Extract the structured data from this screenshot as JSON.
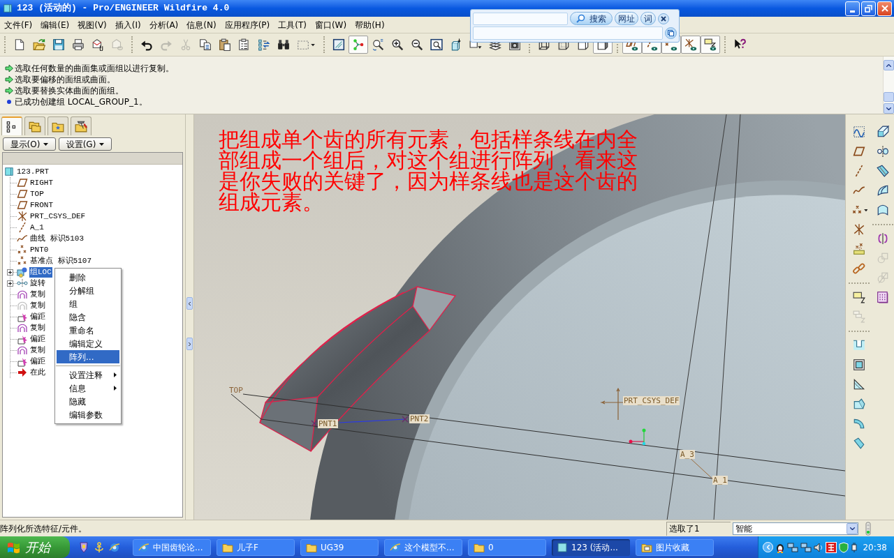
{
  "window": {
    "title": "123 (活动的) - Pro/ENGINEER Wildfire 4.0"
  },
  "search_popup": {
    "search_button": "搜索",
    "tabs": [
      "网址",
      "词"
    ]
  },
  "menu": [
    "文件(F)",
    "编辑(E)",
    "视图(V)",
    "插入(I)",
    "分析(A)",
    "信息(N)",
    "应用程序(P)",
    "工具(T)",
    "窗口(W)",
    "帮助(H)"
  ],
  "toolbar": [
    [
      {
        "kind": "new",
        "disabled": false,
        "pressed": false
      },
      {
        "kind": "open",
        "disabled": false,
        "pressed": false
      },
      {
        "kind": "save",
        "disabled": false,
        "pressed": false
      },
      {
        "kind": "print",
        "disabled": false,
        "pressed": false
      },
      {
        "kind": "mail",
        "disabled": false,
        "pressed": false
      },
      {
        "kind": "sendlink",
        "disabled": true,
        "pressed": false
      }
    ],
    [
      {
        "kind": "undo",
        "disabled": false,
        "pressed": false
      },
      {
        "kind": "redo",
        "disabled": true,
        "pressed": false
      },
      {
        "kind": "cut",
        "disabled": true,
        "pressed": false
      },
      {
        "kind": "copy",
        "disabled": false,
        "pressed": false
      },
      {
        "kind": "paste",
        "disabled": false,
        "pressed": false
      },
      {
        "kind": "pastespecial",
        "disabled": false,
        "pressed": false
      },
      {
        "kind": "regenerate",
        "disabled": false,
        "pressed": false
      },
      {
        "kind": "find",
        "disabled": false,
        "pressed": false
      },
      {
        "kind": "selectbox",
        "disabled": false,
        "pressed": false
      }
    ],
    [
      {
        "kind": "repaint",
        "disabled": false,
        "pressed": false
      },
      {
        "kind": "spincenter",
        "disabled": false,
        "pressed": true
      },
      {
        "kind": "orient",
        "disabled": false,
        "pressed": false
      },
      {
        "kind": "zoomin",
        "disabled": false,
        "pressed": false
      },
      {
        "kind": "zoomout",
        "disabled": false,
        "pressed": false
      },
      {
        "kind": "refit",
        "disabled": false,
        "pressed": false
      },
      {
        "kind": "reorient",
        "disabled": false,
        "pressed": false
      },
      {
        "kind": "views",
        "disabled": false,
        "pressed": false
      },
      {
        "kind": "layers",
        "disabled": false,
        "pressed": false
      },
      {
        "kind": "camera",
        "disabled": false,
        "pressed": false
      }
    ],
    [
      {
        "kind": "wireframe",
        "disabled": false,
        "pressed": false
      },
      {
        "kind": "hidden",
        "disabled": false,
        "pressed": false
      },
      {
        "kind": "nohidden",
        "disabled": false,
        "pressed": false
      },
      {
        "kind": "shaded",
        "disabled": false,
        "pressed": true
      }
    ],
    [
      {
        "kind": "planes",
        "disabled": false,
        "pressed": true
      },
      {
        "kind": "axes",
        "disabled": false,
        "pressed": true
      },
      {
        "kind": "points",
        "disabled": false,
        "pressed": true
      },
      {
        "kind": "csystoggle",
        "disabled": false,
        "pressed": true
      },
      {
        "kind": "annot",
        "disabled": false,
        "pressed": true
      }
    ],
    [
      {
        "kind": "help",
        "disabled": false,
        "pressed": false
      }
    ]
  ],
  "messages": [
    {
      "kind": "prompt",
      "text": "选取任何数量的曲面集或面组以进行复制。"
    },
    {
      "kind": "prompt",
      "text": "选取要偏移的面组或曲面。"
    },
    {
      "kind": "prompt",
      "text": "选取要替换实体曲面的面组。"
    },
    {
      "kind": "info",
      "text": "已成功创建组 LOCAL_GROUP_1。"
    }
  ],
  "model_tree": {
    "tabs": [
      {
        "kind": "tree",
        "selected": true
      },
      {
        "kind": "folders",
        "selected": false
      },
      {
        "kind": "favorites",
        "selected": false
      },
      {
        "kind": "tools",
        "selected": false
      }
    ],
    "menus": [
      "显示(O)",
      "设置(G)"
    ],
    "root": {
      "label": "123.PRT",
      "kind": "part",
      "children": [
        {
          "label": "RIGHT",
          "kind": "plane",
          "collapsed": false,
          "selected": false
        },
        {
          "label": "TOP",
          "kind": "plane",
          "collapsed": false,
          "selected": false
        },
        {
          "label": "FRONT",
          "kind": "plane",
          "collapsed": false,
          "selected": false
        },
        {
          "label": "PRT_CSYS_DEF",
          "kind": "csys",
          "collapsed": false,
          "selected": false
        },
        {
          "label": "A_1",
          "kind": "axis",
          "collapsed": false,
          "selected": false
        },
        {
          "label": "曲线 标识5103",
          "kind": "curve",
          "collapsed": false,
          "selected": false
        },
        {
          "label": "PNT0",
          "kind": "points",
          "collapsed": false,
          "selected": false
        },
        {
          "label": "基准点 标识5107",
          "kind": "points",
          "collapsed": false,
          "selected": false
        },
        {
          "label": "组LOC",
          "kind": "group",
          "collapsed": true,
          "selected": true
        },
        {
          "label": "旋转",
          "kind": "revolve",
          "collapsed": true,
          "selected": false
        },
        {
          "label": "复制",
          "kind": "copy",
          "collapsed": false,
          "selected": false
        },
        {
          "label": "复制",
          "kind": "copyhidden",
          "collapsed": false,
          "selected": false
        },
        {
          "label": "偏距",
          "kind": "offset",
          "collapsed": false,
          "selected": false
        },
        {
          "label": "复制",
          "kind": "copy",
          "collapsed": false,
          "selected": false
        },
        {
          "label": "偏距",
          "kind": "offset",
          "collapsed": false,
          "selected": false
        },
        {
          "label": "复制",
          "kind": "copy",
          "collapsed": false,
          "selected": false
        },
        {
          "label": "偏距",
          "kind": "offset",
          "collapsed": false,
          "selected": false
        },
        {
          "label": "在此",
          "kind": "insert",
          "collapsed": false,
          "selected": false
        }
      ]
    }
  },
  "context_menu": {
    "groups": [
      [
        {
          "label": "删除",
          "selected": false,
          "submenu": false
        },
        {
          "label": "分解组",
          "selected": false,
          "submenu": false
        },
        {
          "label": "组",
          "selected": false,
          "submenu": false
        },
        {
          "label": "隐含",
          "selected": false,
          "submenu": false
        },
        {
          "label": "重命名",
          "selected": false,
          "submenu": false
        },
        {
          "label": "编辑定义",
          "selected": false,
          "submenu": false
        },
        {
          "label": "阵列...",
          "selected": true,
          "submenu": false
        }
      ],
      [
        {
          "label": "设置注释",
          "selected": false,
          "submenu": true
        },
        {
          "label": "信息",
          "selected": false,
          "submenu": true
        },
        {
          "label": "隐藏",
          "selected": false,
          "submenu": false
        },
        {
          "label": "编辑参数",
          "selected": false,
          "submenu": false
        }
      ]
    ]
  },
  "viewport": {
    "annotation": "把组成单个齿的所有元素，包括样条线在内全部组成一个组后，对这个组进行阵列，看来这是你失败的关键了，因为样条线也是这个齿的组成元素。",
    "datum_labels": [
      {
        "text": "TOP",
        "kind": "plane"
      },
      {
        "text": "PNT1",
        "kind": "point"
      },
      {
        "text": "PNT2",
        "kind": "point"
      },
      {
        "text": "PRT_CSYS_DEF",
        "kind": "csys"
      },
      {
        "text": "A_3",
        "kind": "axis"
      },
      {
        "text": "A_1",
        "kind": "axis"
      }
    ]
  },
  "right_toolbar": {
    "columns": [
      [
        [
          {
            "kind": "sketch",
            "disabled": false
          },
          {
            "kind": "plane",
            "disabled": false
          },
          {
            "kind": "axis",
            "disabled": false
          },
          {
            "kind": "curve",
            "disabled": false
          },
          {
            "kind": "point",
            "disabled": false
          },
          {
            "kind": "csys",
            "disabled": false
          },
          {
            "kind": "pointbar",
            "disabled": false
          },
          {
            "kind": "chain",
            "disabled": false
          }
        ],
        [
          {
            "kind": "group",
            "disabled": false
          },
          {
            "kind": "groupstack",
            "disabled": true
          }
        ],
        [
          {
            "kind": "hole",
            "disabled": false
          },
          {
            "kind": "shell",
            "disabled": false
          },
          {
            "kind": "rib",
            "disabled": false
          },
          {
            "kind": "draft",
            "disabled": false
          },
          {
            "kind": "round",
            "disabled": false
          },
          {
            "kind": "chamfer",
            "disabled": false
          }
        ]
      ],
      [
        [
          {
            "kind": "extrude",
            "disabled": false
          },
          {
            "kind": "revolvefeat",
            "disabled": false
          },
          {
            "kind": "sweep",
            "disabled": false
          },
          {
            "kind": "blend",
            "disabled": false
          },
          {
            "kind": "boundary",
            "disabled": false
          }
        ],
        [
          {
            "kind": "mirror",
            "disabled": false
          },
          {
            "kind": "merge",
            "disabled": true
          },
          {
            "kind": "trim",
            "disabled": true
          },
          {
            "kind": "pattern",
            "disabled": false
          }
        ]
      ]
    ]
  },
  "status_bar": {
    "message": "阵列化所选特征/元件。",
    "selection": "选取了1",
    "filter": "智能"
  },
  "taskbar": {
    "start": "开始",
    "tasks": [
      {
        "label": "中国齿轮论...",
        "kind": "browser",
        "selected": false
      },
      {
        "label": "儿子F",
        "kind": "folder",
        "selected": false
      },
      {
        "label": "UG39",
        "kind": "folder",
        "selected": false
      },
      {
        "label": "这个模型不...",
        "kind": "browser",
        "selected": false
      },
      {
        "label": "0",
        "kind": "folder",
        "selected": false
      },
      {
        "label": "123 (活动...",
        "kind": "proe",
        "selected": true
      },
      {
        "label": "图片收藏",
        "kind": "pictures",
        "selected": false
      }
    ],
    "clock": "20:38"
  }
}
